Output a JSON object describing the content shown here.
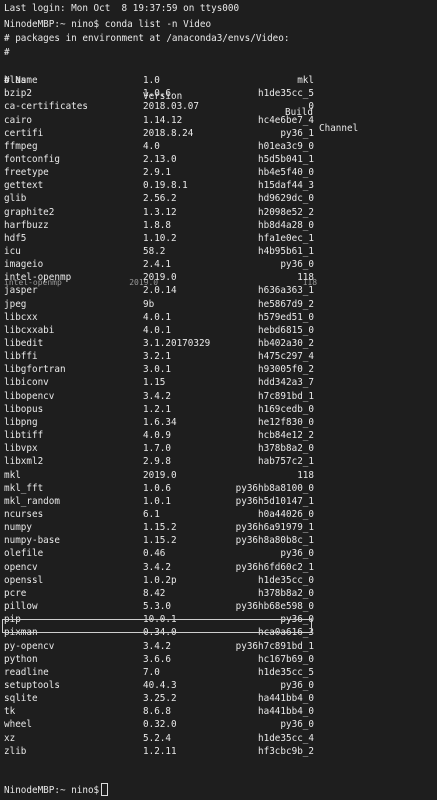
{
  "last_login": "Last login: Mon Oct  8 19:37:59 on ttys000",
  "command_line": "NinodeMBP:~ nino$ conda list -n Video",
  "env_comment": "# packages in environment at /anaconda3/envs/Video:",
  "hash_line": "#",
  "header": {
    "name": "# Name",
    "version": "Version",
    "build": "Build",
    "channel": "Channel"
  },
  "packages": [
    {
      "name": "blas",
      "version": "1.0",
      "build": "mkl"
    },
    {
      "name": "bzip2",
      "version": "1.0.6",
      "build": "h1de35cc_5"
    },
    {
      "name": "ca-certificates",
      "version": "2018.03.07",
      "build": "0"
    },
    {
      "name": "cairo",
      "version": "1.14.12",
      "build": "hc4e6be7_4"
    },
    {
      "name": "certifi",
      "version": "2018.8.24",
      "build": "py36_1"
    },
    {
      "name": "ffmpeg",
      "version": "4.0",
      "build": "h01ea3c9_0"
    },
    {
      "name": "fontconfig",
      "version": "2.13.0",
      "build": "h5d5b041_1"
    },
    {
      "name": "freetype",
      "version": "2.9.1",
      "build": "hb4e5f40_0"
    },
    {
      "name": "gettext",
      "version": "0.19.8.1",
      "build": "h15daf44_3"
    },
    {
      "name": "glib",
      "version": "2.56.2",
      "build": "hd9629dc_0"
    },
    {
      "name": "graphite2",
      "version": "1.3.12",
      "build": "h2098e52_2"
    },
    {
      "name": "harfbuzz",
      "version": "1.8.8",
      "build": "hb8d4a28_0"
    },
    {
      "name": "hdf5",
      "version": "1.10.2",
      "build": "hfa1e0ec_1"
    },
    {
      "name": "icu",
      "version": "58.2",
      "build": "h4b95b61_1"
    },
    {
      "name": "imageio",
      "version": "2.4.1",
      "build": "py36_0"
    },
    {
      "name": "intel-openmp",
      "version": "2019.0",
      "build": "118"
    },
    {
      "name": "jasper",
      "version": "2.0.14",
      "build": "h636a363_1"
    },
    {
      "name": "jpeg",
      "version": "9b",
      "build": "he5867d9_2"
    },
    {
      "name": "libcxx",
      "version": "4.0.1",
      "build": "h579ed51_0"
    },
    {
      "name": "libcxxabi",
      "version": "4.0.1",
      "build": "hebd6815_0"
    },
    {
      "name": "libedit",
      "version": "3.1.20170329",
      "build": "hb402a30_2"
    },
    {
      "name": "libffi",
      "version": "3.2.1",
      "build": "h475c297_4"
    },
    {
      "name": "libgfortran",
      "version": "3.0.1",
      "build": "h93005f0_2"
    },
    {
      "name": "libiconv",
      "version": "1.15",
      "build": "hdd342a3_7"
    },
    {
      "name": "libopencv",
      "version": "3.4.2",
      "build": "h7c891bd_1"
    },
    {
      "name": "libopus",
      "version": "1.2.1",
      "build": "h169cedb_0"
    },
    {
      "name": "libpng",
      "version": "1.6.34",
      "build": "he12f830_0"
    },
    {
      "name": "libtiff",
      "version": "4.0.9",
      "build": "hcb84e12_2"
    },
    {
      "name": "libvpx",
      "version": "1.7.0",
      "build": "h378b8a2_0"
    },
    {
      "name": "libxml2",
      "version": "2.9.8",
      "build": "hab757c2_1"
    },
    {
      "name": "mkl",
      "version": "2019.0",
      "build": "118"
    },
    {
      "name": "mkl_fft",
      "version": "1.0.6",
      "build": "py36hb8a8100_0"
    },
    {
      "name": "mkl_random",
      "version": "1.0.1",
      "build": "py36h5d10147_1"
    },
    {
      "name": "ncurses",
      "version": "6.1",
      "build": "h0a44026_0"
    },
    {
      "name": "numpy",
      "version": "1.15.2",
      "build": "py36h6a91979_1"
    },
    {
      "name": "numpy-base",
      "version": "1.15.2",
      "build": "py36h8a80b8c_1"
    },
    {
      "name": "olefile",
      "version": "0.46",
      "build": "py36_0"
    },
    {
      "name": "opencv",
      "version": "3.4.2",
      "build": "py36h6fd60c2_1"
    },
    {
      "name": "openssl",
      "version": "1.0.2p",
      "build": "h1de35cc_0"
    },
    {
      "name": "pcre",
      "version": "8.42",
      "build": "h378b8a2_0"
    },
    {
      "name": "pillow",
      "version": "5.3.0",
      "build": "py36hb68e598_0"
    },
    {
      "name": "pip",
      "version": "10.0.1",
      "build": "py36_0"
    },
    {
      "name": "pixman",
      "version": "0.34.0",
      "build": "hca0a616_3"
    },
    {
      "name": "py-opencv",
      "version": "3.4.2",
      "build": "py36h7c891bd_1"
    },
    {
      "name": "python",
      "version": "3.6.6",
      "build": "hc167b69_0"
    },
    {
      "name": "readline",
      "version": "7.0",
      "build": "h1de35cc_5"
    },
    {
      "name": "setuptools",
      "version": "40.4.3",
      "build": "py36_0"
    },
    {
      "name": "sqlite",
      "version": "3.25.2",
      "build": "ha441bb4_0"
    },
    {
      "name": "tk",
      "version": "8.6.8",
      "build": "ha441bb4_0"
    },
    {
      "name": "wheel",
      "version": "0.32.0",
      "build": "py36_0"
    },
    {
      "name": "xz",
      "version": "5.2.4",
      "build": "h1de35cc_4"
    },
    {
      "name": "zlib",
      "version": "1.2.11",
      "build": "hf3cbc9b_2"
    }
  ],
  "final_prompt": "NinodeMBP:~ nino$",
  "colors": {
    "background": "#1e1e1e",
    "text": "#e9e9e9",
    "cursor": "#dcdcdc"
  }
}
